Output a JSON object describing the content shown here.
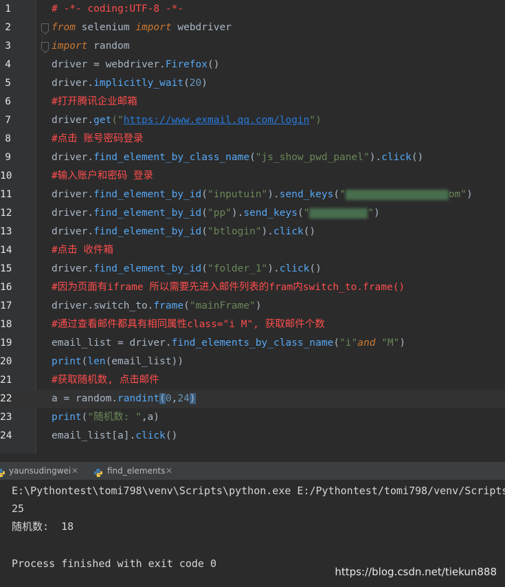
{
  "colors": {
    "editor_bg": "#2b2b2b",
    "gutter_bg": "#313335",
    "comment": "#ff4d4d",
    "keyword": "#cc7832",
    "string": "#6a8759",
    "number": "#6897bb",
    "identifier": "#a9b7c6",
    "method": "#56a8f5",
    "link": "#287bde"
  },
  "editor": {
    "lines": [
      {
        "n": "1",
        "segments": [
          {
            "t": "# -*- coding:UTF-8 -*-",
            "c": "comment"
          }
        ]
      },
      {
        "n": "2",
        "fold": true,
        "segments": [
          {
            "t": "from",
            "c": "kw-italic"
          },
          {
            "t": " selenium ",
            "c": "id"
          },
          {
            "t": "import",
            "c": "kw-italic"
          },
          {
            "t": " webdriver",
            "c": "id"
          }
        ]
      },
      {
        "n": "3",
        "fold": true,
        "segments": [
          {
            "t": "import",
            "c": "kw-italic"
          },
          {
            "t": " random",
            "c": "id"
          }
        ]
      },
      {
        "n": "4",
        "segments": [
          {
            "t": "driver = webdriver.",
            "c": "id"
          },
          {
            "t": "Firefox",
            "c": "method"
          },
          {
            "t": "()",
            "c": "id"
          }
        ]
      },
      {
        "n": "5",
        "segments": [
          {
            "t": "driver.",
            "c": "id"
          },
          {
            "t": "implicitly_wait",
            "c": "method"
          },
          {
            "t": "(",
            "c": "id"
          },
          {
            "t": "20",
            "c": "num"
          },
          {
            "t": ")",
            "c": "id"
          }
        ]
      },
      {
        "n": "6",
        "segments": [
          {
            "t": "#打开腾讯企业邮箱",
            "c": "comment"
          }
        ]
      },
      {
        "n": "7",
        "segments": [
          {
            "t": "driver.",
            "c": "id"
          },
          {
            "t": "get",
            "c": "method"
          },
          {
            "t": "(\"",
            "c": "str"
          },
          {
            "t": "https://www.exmail.qq.com/login",
            "c": "link"
          },
          {
            "t": "\")",
            "c": "str"
          }
        ]
      },
      {
        "n": "8",
        "segments": [
          {
            "t": "#点击 账号密码登录",
            "c": "comment"
          }
        ]
      },
      {
        "n": "9",
        "segments": [
          {
            "t": "driver.",
            "c": "id"
          },
          {
            "t": "find_element_by_class_name",
            "c": "method"
          },
          {
            "t": "(",
            "c": "id"
          },
          {
            "t": "\"js_show_pwd_panel\"",
            "c": "str"
          },
          {
            "t": ").",
            "c": "id"
          },
          {
            "t": "click",
            "c": "method"
          },
          {
            "t": "()",
            "c": "id"
          }
        ]
      },
      {
        "n": "10",
        "segments": [
          {
            "t": "#输入账户和密码 登录",
            "c": "comment"
          }
        ]
      },
      {
        "n": "11",
        "segments": [
          {
            "t": "driver.",
            "c": "id"
          },
          {
            "t": "find_element_by_id",
            "c": "method"
          },
          {
            "t": "(",
            "c": "id"
          },
          {
            "t": "\"inputuin\"",
            "c": "str"
          },
          {
            "t": ").",
            "c": "id"
          },
          {
            "t": "send_keys",
            "c": "method"
          },
          {
            "t": "(",
            "c": "id"
          },
          {
            "t": "\"",
            "c": "str"
          },
          {
            "t": "",
            "c": "blur",
            "w": 150
          },
          {
            "t": "om\"",
            "c": "str"
          },
          {
            "t": ")",
            "c": "id"
          }
        ]
      },
      {
        "n": "12",
        "segments": [
          {
            "t": "driver.",
            "c": "id"
          },
          {
            "t": "find_element_by_id",
            "c": "method"
          },
          {
            "t": "(",
            "c": "id"
          },
          {
            "t": "\"pp\"",
            "c": "str"
          },
          {
            "t": ").",
            "c": "id"
          },
          {
            "t": "send_keys",
            "c": "method"
          },
          {
            "t": "(",
            "c": "id"
          },
          {
            "t": "\"",
            "c": "str"
          },
          {
            "t": "",
            "c": "blur",
            "w": 85
          },
          {
            "t": "\"",
            "c": "str"
          },
          {
            "t": ")",
            "c": "id"
          }
        ]
      },
      {
        "n": "13",
        "segments": [
          {
            "t": "driver.",
            "c": "id"
          },
          {
            "t": "find_element_by_id",
            "c": "method"
          },
          {
            "t": "(",
            "c": "id"
          },
          {
            "t": "\"btlogin\"",
            "c": "str"
          },
          {
            "t": ").",
            "c": "id"
          },
          {
            "t": "click",
            "c": "method"
          },
          {
            "t": "()",
            "c": "id"
          }
        ]
      },
      {
        "n": "14",
        "segments": [
          {
            "t": "#点击 收件箱",
            "c": "comment"
          }
        ]
      },
      {
        "n": "15",
        "segments": [
          {
            "t": "driver.",
            "c": "id"
          },
          {
            "t": "find_element_by_id",
            "c": "method"
          },
          {
            "t": "(",
            "c": "id"
          },
          {
            "t": "\"folder_1\"",
            "c": "str"
          },
          {
            "t": ").",
            "c": "id"
          },
          {
            "t": "click",
            "c": "method"
          },
          {
            "t": "()",
            "c": "id"
          }
        ]
      },
      {
        "n": "16",
        "segments": [
          {
            "t": "#因为页面有iframe 所以需要先进入邮件列表的fram内switch_to.frame()",
            "c": "comment"
          }
        ]
      },
      {
        "n": "17",
        "segments": [
          {
            "t": "driver.",
            "c": "id"
          },
          {
            "t": "switch_to.",
            "c": "id"
          },
          {
            "t": "frame",
            "c": "method"
          },
          {
            "t": "(",
            "c": "id"
          },
          {
            "t": "\"mainFrame\"",
            "c": "str"
          },
          {
            "t": ")",
            "c": "id"
          }
        ]
      },
      {
        "n": "18",
        "segments": [
          {
            "t": "#通过查看邮件都具有相同属性class=\"i M\", 获取邮件个数",
            "c": "comment"
          }
        ]
      },
      {
        "n": "19",
        "segments": [
          {
            "t": "email_list = driver.",
            "c": "id"
          },
          {
            "t": "find_elements_by_class_name",
            "c": "method"
          },
          {
            "t": "(",
            "c": "id"
          },
          {
            "t": "\"i\"",
            "c": "str"
          },
          {
            "t": "and",
            "c": "kw-italic"
          },
          {
            "t": " ",
            "c": "id"
          },
          {
            "t": "\"M\"",
            "c": "str"
          },
          {
            "t": ")",
            "c": "id"
          }
        ]
      },
      {
        "n": "20",
        "segments": [
          {
            "t": "print",
            "c": "method"
          },
          {
            "t": "(",
            "c": "id"
          },
          {
            "t": "len",
            "c": "method"
          },
          {
            "t": "(email_list))",
            "c": "id"
          }
        ]
      },
      {
        "n": "21",
        "segments": [
          {
            "t": "#获取随机数, 点击邮件",
            "c": "comment"
          }
        ]
      },
      {
        "n": "22",
        "current": true,
        "segments": [
          {
            "t": "a = random.",
            "c": "id"
          },
          {
            "t": "randint",
            "c": "method"
          },
          {
            "t": "(",
            "c": "paren"
          },
          {
            "t": "0",
            "c": "num"
          },
          {
            "t": ",",
            "c": "id"
          },
          {
            "t": "24",
            "c": "num"
          },
          {
            "t": ")",
            "c": "paren"
          }
        ]
      },
      {
        "n": "23",
        "segments": [
          {
            "t": "print",
            "c": "method"
          },
          {
            "t": "(",
            "c": "id"
          },
          {
            "t": "\"随机数: \"",
            "c": "str"
          },
          {
            "t": ",a)",
            "c": "id"
          }
        ]
      },
      {
        "n": "24",
        "segments": [
          {
            "t": "email_list[a].",
            "c": "id"
          },
          {
            "t": "click",
            "c": "method"
          },
          {
            "t": "()",
            "c": "id"
          }
        ]
      }
    ]
  },
  "tabs": [
    {
      "label": "yaunsudingwei",
      "icon": "python-icon"
    },
    {
      "label": "find_elements",
      "icon": "python-icon"
    }
  ],
  "console": {
    "lines": [
      "E:\\Pythontest\\tomi798\\venv\\Scripts\\python.exe E:/Pythontest/tomi798/venv/Scripts",
      "25",
      "随机数:  18",
      "",
      "Process finished with exit code 0"
    ]
  },
  "watermark": "https://blog.csdn.net/tiekun888"
}
